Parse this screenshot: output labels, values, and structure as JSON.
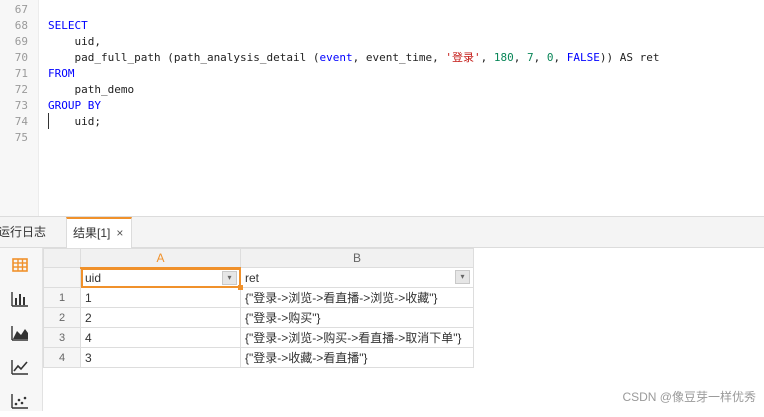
{
  "editor": {
    "lines": [
      {
        "n": "67",
        "parts": []
      },
      {
        "n": "68",
        "parts": [
          {
            "t": "SELECT",
            "c": "kw"
          }
        ]
      },
      {
        "n": "69",
        "parts": [
          {
            "t": "    uid,",
            "c": ""
          }
        ]
      },
      {
        "n": "70",
        "parts": [
          {
            "t": "    pad_full_path (path_analysis_detail (",
            "c": ""
          },
          {
            "t": "event",
            "c": "kw"
          },
          {
            "t": ", event_time, ",
            "c": ""
          },
          {
            "t": "'登录'",
            "c": "str"
          },
          {
            "t": ", ",
            "c": ""
          },
          {
            "t": "180",
            "c": "num"
          },
          {
            "t": ", ",
            "c": ""
          },
          {
            "t": "7",
            "c": "num"
          },
          {
            "t": ", ",
            "c": ""
          },
          {
            "t": "0",
            "c": "num"
          },
          {
            "t": ", ",
            "c": ""
          },
          {
            "t": "FALSE",
            "c": "kw"
          },
          {
            "t": ")) AS ret",
            "c": ""
          }
        ]
      },
      {
        "n": "71",
        "parts": [
          {
            "t": "FROM",
            "c": "kw"
          }
        ]
      },
      {
        "n": "72",
        "parts": [
          {
            "t": "    path_demo",
            "c": ""
          }
        ]
      },
      {
        "n": "73",
        "parts": [
          {
            "t": "GROUP BY",
            "c": "kw"
          }
        ]
      },
      {
        "n": "74",
        "parts": [
          {
            "t": "    uid;",
            "c": ""
          }
        ]
      },
      {
        "n": "75",
        "parts": []
      }
    ]
  },
  "tabs": {
    "log_label": "运行日志",
    "result_label": "结果[1]",
    "close_glyph": "×"
  },
  "toolbar": {
    "icons": [
      "table-icon",
      "bar-chart-icon",
      "area-chart-icon",
      "line-chart-icon",
      "scatter-chart-icon"
    ]
  },
  "grid": {
    "col_letters": [
      "A",
      "B"
    ],
    "fields": [
      "uid",
      "ret"
    ],
    "dropdown_glyph": "▾",
    "rows": [
      {
        "n": "1",
        "uid": "1",
        "ret": "{\"登录->浏览->看直播->浏览->收藏\"}"
      },
      {
        "n": "2",
        "uid": "2",
        "ret": "{\"登录->购买\"}"
      },
      {
        "n": "3",
        "uid": "4",
        "ret": "{\"登录->浏览->购买->看直播->取消下单\"}"
      },
      {
        "n": "4",
        "uid": "3",
        "ret": "{\"登录->收藏->看直播\"}"
      }
    ]
  },
  "watermark": "CSDN @像豆芽一样优秀",
  "colors": {
    "accent": "#f0912b",
    "keyword": "#0000ff",
    "string": "#c41a16",
    "number": "#098658"
  }
}
